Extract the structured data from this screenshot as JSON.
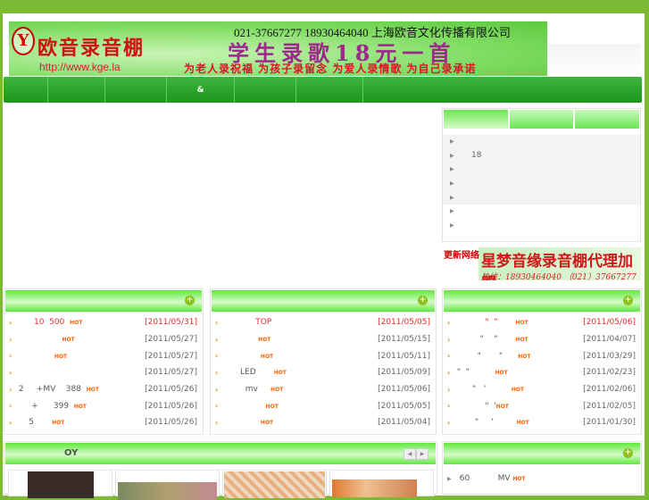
{
  "banner": {
    "logo_letter": "Y",
    "title": "欧音录音棚",
    "url": "http://www.kge.la",
    "phone": "021-37667277   18930464040 上海欧音文化传播有限公司",
    "slogan": "学生录歌18元一首",
    "subslogan": "为老人录祝福 为孩子录留念 为爱人录情歌 为自己录承诺"
  },
  "nav": {
    "items": [
      "",
      "",
      "",
      "&",
      "",
      "",
      ""
    ]
  },
  "side_tabs": {
    "items": [
      "",
      "18",
      "",
      "",
      "",
      "",
      ""
    ]
  },
  "ad": {
    "logo_text": "更新网络",
    "title": "星梦音缘录音棚代理加盟",
    "phone": "热线：18930464040 （021）37667277"
  },
  "colors": {
    "accent": "#7cb935",
    "nav": "#229a22",
    "hot": "#ff6000",
    "date_new": "#e52b2b"
  },
  "panels": [
    {
      "rows": [
        {
          "text": "       10  500  ",
          "hot": "HOT",
          "date": "[2011/05/31]"
        },
        {
          "text": "                  ",
          "hot": "HOT",
          "date": "[2011/05/27]"
        },
        {
          "text": "               ",
          "hot": "HOT",
          "date": "[2011/05/27]"
        },
        {
          "text": "",
          "hot": "",
          "date": "[2011/05/27]"
        },
        {
          "text": " 2     +MV    388  ",
          "hot": "HOT",
          "date": "[2011/05/26]"
        },
        {
          "text": "      +      399  ",
          "hot": "HOT",
          "date": "[2011/05/26]"
        },
        {
          "text": "     5       ",
          "hot": "HOT",
          "date": "[2011/05/26]"
        }
      ]
    },
    {
      "rows": [
        {
          "text": "             TOP",
          "hot": "",
          "date": "[2011/05/05]"
        },
        {
          "text": "              ",
          "hot": "HOT",
          "date": "[2011/05/15]"
        },
        {
          "text": "               ",
          "hot": "HOT",
          "date": "[2011/05/11]"
        },
        {
          "text": "       LED       ",
          "hot": "HOT",
          "date": "[2011/05/09]"
        },
        {
          "text": "         mv     ",
          "hot": "HOT",
          "date": "[2011/05/06]"
        },
        {
          "text": "                 ",
          "hot": "HOT",
          "date": "[2011/05/05]"
        },
        {
          "text": "               ",
          "hot": "HOT",
          "date": "[2011/05/04]"
        }
      ]
    },
    {
      "rows": [
        {
          "text": "            \"  \"       ",
          "hot": "HOT",
          "date": "[2011/05/06]"
        },
        {
          "text": "          \"    \"       ",
          "hot": "HOT",
          "date": "[2011/04/07]"
        },
        {
          "text": "         \"       \"      ",
          "hot": "HOT",
          "date": "[2011/03/29]"
        },
        {
          "text": " \"  \"          ",
          "hot": "HOT",
          "date": "[2011/02/23]"
        },
        {
          "text": "       \"   '          ",
          "hot": "HOT",
          "date": "[2011/02/06]"
        },
        {
          "text": "            \"  '",
          "hot": "HOT",
          "date": "[2011/02/05]"
        },
        {
          "text": "        \"     '         ",
          "hot": "HOT",
          "date": "[2011/01/30]"
        }
      ]
    }
  ],
  "bottom_left": {
    "title": "OY"
  },
  "bottom_right": {
    "rows": [
      {
        "text": "  60           MV ",
        "hot": "HOT"
      }
    ]
  }
}
